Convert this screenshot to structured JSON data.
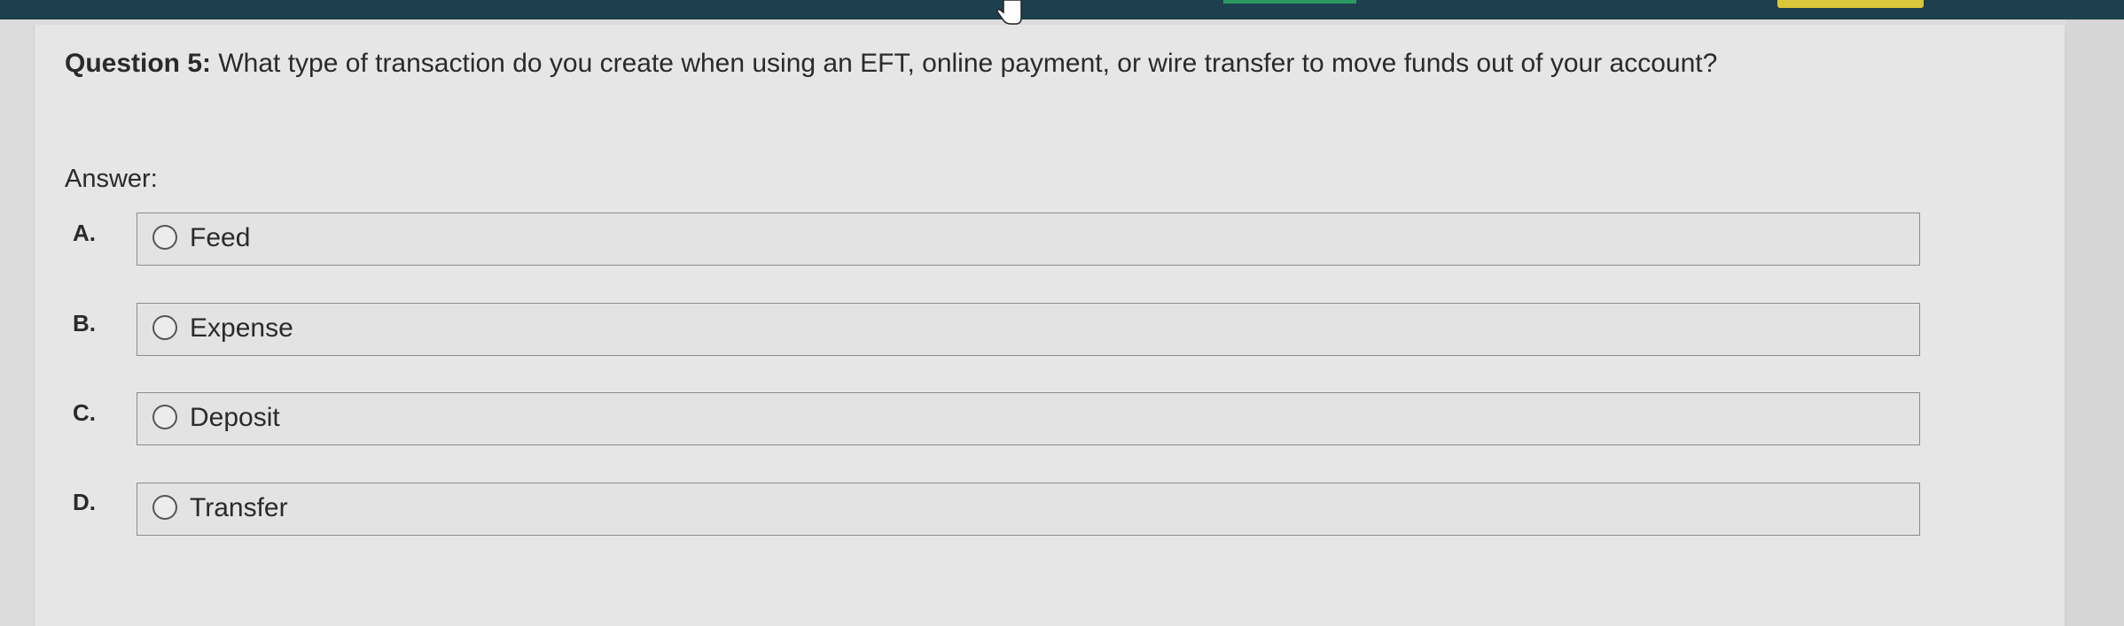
{
  "question": {
    "label": "Question 5:",
    "text": "What type of transaction do you create when using an EFT, online payment, or wire transfer to move funds out of your account?"
  },
  "answer_label": "Answer:",
  "choices": [
    {
      "letter": "A.",
      "text": "Feed",
      "selected": false
    },
    {
      "letter": "B.",
      "text": "Expense",
      "selected": false
    },
    {
      "letter": "C.",
      "text": "Deposit",
      "selected": false
    },
    {
      "letter": "D.",
      "text": "Transfer",
      "selected": false
    }
  ],
  "colors": {
    "top_bar": "#1e3f4e",
    "accent_green": "#2a9a62",
    "accent_yellow": "#d9c63a",
    "background": "#dcdcdc"
  }
}
